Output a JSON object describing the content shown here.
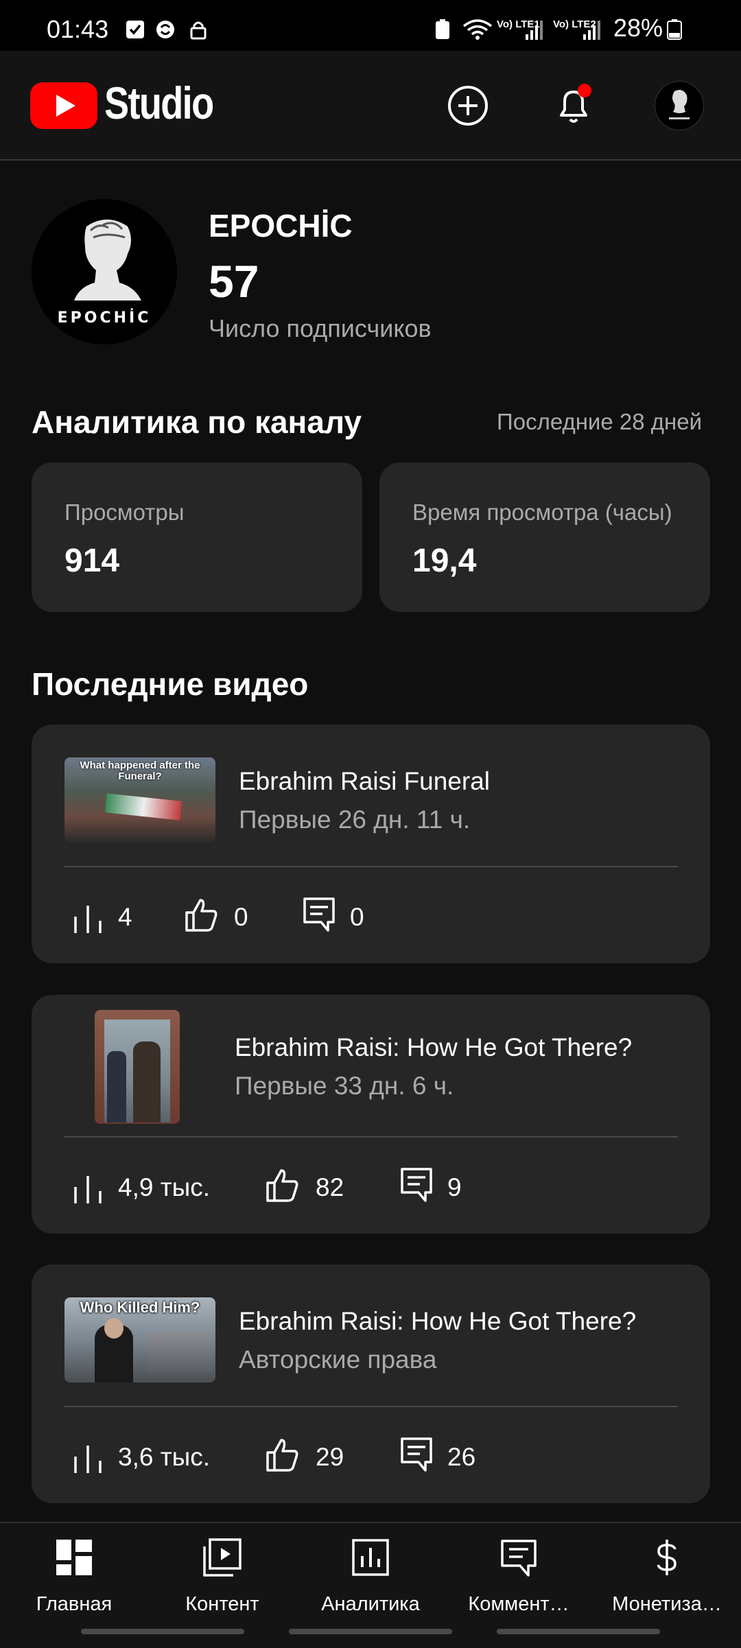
{
  "status_bar": {
    "time": "01:43",
    "network_1": "Vo) LTE1",
    "network_2": "Vo) LTE2",
    "battery": "28%"
  },
  "app_bar": {
    "title": "Studio",
    "create_icon": "add-circle-icon",
    "notifications_icon": "bell-icon",
    "notification_dot_color": "#ff0000"
  },
  "channel": {
    "name": "EPOCHİC",
    "subscribers": "57",
    "subscribers_label": "Число подписчиков",
    "avatar_text": "EPOCHİC"
  },
  "analytics": {
    "title": "Аналитика по каналу",
    "period": "Последние 28 дней",
    "metrics": [
      {
        "label": "Просмотры",
        "value": "914"
      },
      {
        "label": "Время просмотра (часы)",
        "value": "19,4"
      }
    ]
  },
  "recent_videos": {
    "title": "Последние видео",
    "items": [
      {
        "title": "Ebrahim Raisi Funeral",
        "subtitle": "Первые 26 дн. 11 ч.",
        "thumb_caption": "What happened after the Funeral?",
        "views": "4",
        "likes": "0",
        "comments": "0"
      },
      {
        "title": "Ebrahim Raisi: How He Got There?",
        "subtitle": "Первые 33 дн. 6 ч.",
        "thumb_caption": "",
        "views": "4,9 тыс.",
        "likes": "82",
        "comments": "9"
      },
      {
        "title": "Ebrahim Raisi: How He Got There?",
        "subtitle": "Авторские права",
        "thumb_caption": "Who Killed Him?",
        "views": "3,6 тыс.",
        "likes": "29",
        "comments": "26"
      }
    ]
  },
  "bottom_nav": {
    "items": [
      {
        "label": "Главная",
        "icon": "dashboard-icon"
      },
      {
        "label": "Контент",
        "icon": "content-icon"
      },
      {
        "label": "Аналитика",
        "icon": "analytics-icon"
      },
      {
        "label": "Коммент…",
        "icon": "comments-icon"
      },
      {
        "label": "Монетиза…",
        "icon": "dollar-icon"
      }
    ]
  },
  "colors": {
    "background": "#0f0f0f",
    "card": "#262626",
    "accent_red": "#ff0000",
    "muted_text": "#aaaaaa"
  }
}
